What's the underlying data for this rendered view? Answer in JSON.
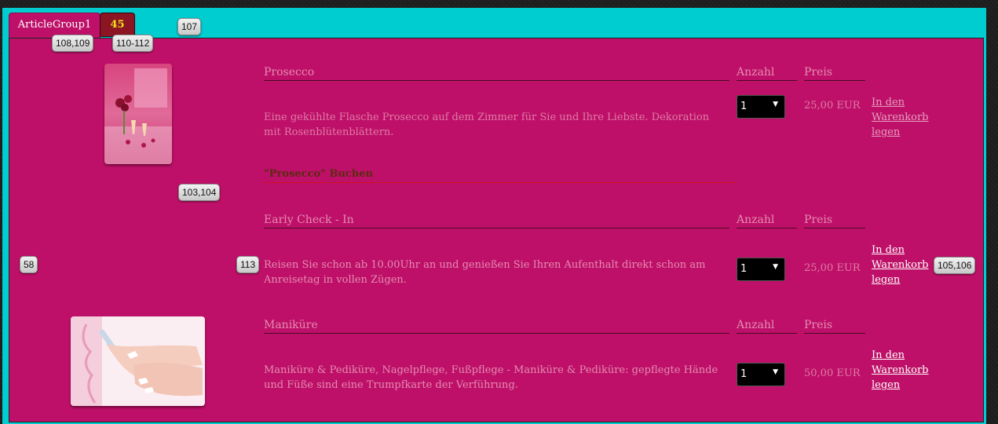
{
  "tabs": [
    {
      "label": "ArticleGroup1",
      "active": true
    },
    {
      "label": "45",
      "active": false
    }
  ],
  "badges": {
    "b1": "108,109",
    "b2": "110-112",
    "b3": "107",
    "b4": "103,104",
    "b5": "58",
    "b6": "113",
    "b7": "105,106"
  },
  "articles": [
    {
      "title": "Prosecco",
      "qty_header": "Anzahl",
      "price_header": "Preis",
      "description": "Eine gekühlte Flasche Prosecco auf dem Zimmer für Sie und Ihre Liebste. Dekoration mit Rosenblütenblättern.",
      "quantity": "1",
      "price": "25,00 EUR",
      "cart_link": "In den Warenkorb legen",
      "booking_label": "\"Prosecco\" Buchen",
      "image_icon": "prosecco-image"
    },
    {
      "title": "Early Check - In",
      "qty_header": "Anzahl",
      "price_header": "Preis",
      "description": "Reisen Sie schon ab 10.00Uhr an und genießen Sie Ihren Aufenthalt direkt schon am Anreisetag in vollen Zügen.",
      "quantity": "1",
      "price": "25,00 EUR",
      "cart_link": "In den Warenkorb legen"
    },
    {
      "title": "Maniküre",
      "qty_header": "Anzahl",
      "price_header": "Preis",
      "description": "Maniküre & Pediküre, Nagelpflege, Fußpflege - Maniküre & Pediküre: gepflegte Hände und Füße sind eine Trumpfkarte der Verführung.",
      "quantity": "1",
      "price": "50,00 EUR",
      "cart_link": "In den Warenkorb legen",
      "image_icon": "manicure-image"
    }
  ],
  "colors": {
    "frame": "#00cdd0",
    "panel": "#be1068",
    "inactive_tab": "#8b1523"
  }
}
